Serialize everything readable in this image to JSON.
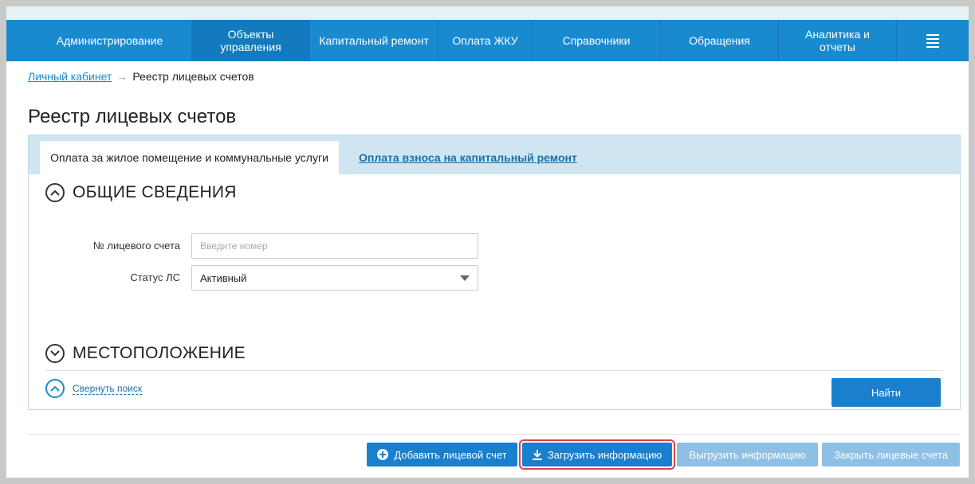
{
  "colors": {
    "nav": "#1a8ad0",
    "primary_button": "#1a7fcc",
    "disabled_button": "#8ec0e5",
    "highlight": "#d9434a"
  },
  "nav": {
    "items": [
      {
        "label": "Администрирование",
        "active": false
      },
      {
        "label": "Объекты управления",
        "active": true
      },
      {
        "label": "Капитальный ремонт",
        "active": false
      },
      {
        "label": "Оплата ЖКУ",
        "active": false
      },
      {
        "label": "Справочники",
        "active": false
      },
      {
        "label": "Обращения",
        "active": false
      },
      {
        "label": "Аналитика и отчеты",
        "active": false
      }
    ],
    "menu_icon": "hamburger-menu-icon"
  },
  "breadcrumb": {
    "home": "Личный кабинет",
    "separator": "→",
    "current": "Реестр лицевых счетов"
  },
  "page_title": "Реестр лицевых счетов",
  "tabs": [
    {
      "label": "Оплата за жилое помещение и коммунальные услуги",
      "active": true
    },
    {
      "label": "Оплата взноса на капитальный ремонт",
      "active": false
    }
  ],
  "sections": {
    "general": {
      "title": "ОБЩИЕ СВЕДЕНИЯ",
      "icon": "chevron-up-circle-icon"
    },
    "location": {
      "title": "МЕСТОПОЛОЖЕНИЕ",
      "icon": "chevron-down-circle-icon"
    }
  },
  "form": {
    "account_number": {
      "label": "№ лицевого счета",
      "placeholder": "Введите номер",
      "value": ""
    },
    "status": {
      "label": "Статус ЛС",
      "value": "Активный"
    }
  },
  "collapse_search": "Свернуть поиск",
  "find_button": "Найти",
  "actions": {
    "add_account": "Добавить лицевой счет",
    "upload_info": "Загрузить информацию",
    "export_info": "Выгрузить информацию",
    "close_accounts": "Закрыть лицевые счета"
  }
}
